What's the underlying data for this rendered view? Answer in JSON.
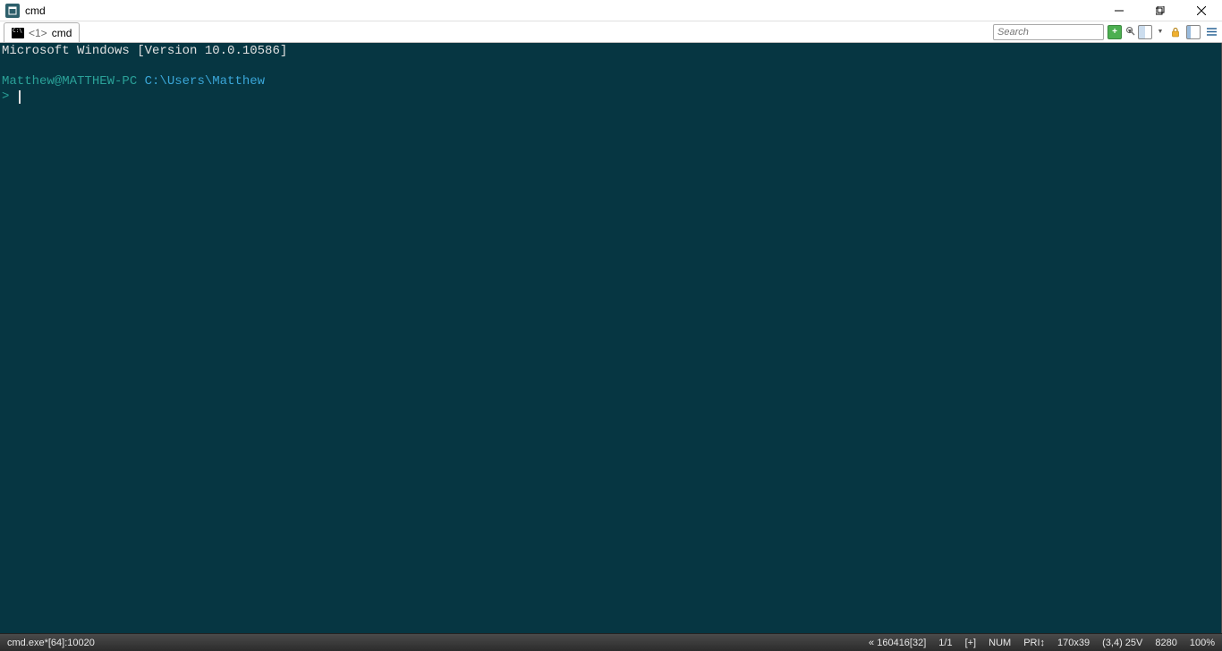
{
  "titlebar": {
    "title": "cmd"
  },
  "tab": {
    "index": "<1>",
    "label": "cmd"
  },
  "search": {
    "placeholder": "Search"
  },
  "terminal": {
    "version_line": "Microsoft Windows [Version 10.0.10586]",
    "user_host": "Matthew@MATTHEW-PC",
    "cwd": "C:\\Users\\Matthew",
    "prompt_symbol": ">"
  },
  "statusbar": {
    "left": "cmd.exe*[64]:10020",
    "clip": "« 160416[32]",
    "tabs": "1/1",
    "input": "[+]",
    "num": "NUM",
    "pri": "PRI↕",
    "size": "170x39",
    "cursor": "(3,4) 25V",
    "pid": "8280",
    "zoom": "100%"
  }
}
